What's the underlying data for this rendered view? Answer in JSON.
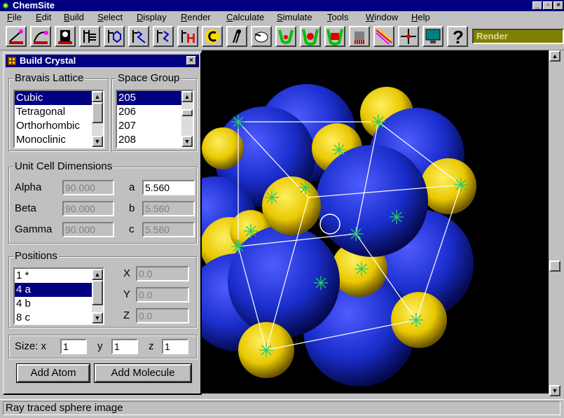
{
  "app": {
    "title": "ChemSite"
  },
  "window_controls": {
    "minimize": "_",
    "restore": "▫",
    "close": "×"
  },
  "menu": [
    {
      "label": "File",
      "mnemonic": "F",
      "rest": "ile"
    },
    {
      "label": "Edit",
      "mnemonic": "E",
      "rest": "dit"
    },
    {
      "label": "Build",
      "mnemonic": "B",
      "rest": "uild"
    },
    {
      "label": "Select",
      "mnemonic": "S",
      "rest": "elect"
    },
    {
      "label": "Display",
      "mnemonic": "D",
      "rest": "isplay"
    },
    {
      "label": "Render",
      "mnemonic": "R",
      "rest": "ender"
    },
    {
      "label": "Calculate",
      "mnemonic": "C",
      "rest": "alculate"
    },
    {
      "label": "Simulate",
      "mnemonic": "S",
      "rest": "imulate"
    },
    {
      "label": "Tools",
      "mnemonic": "T",
      "rest": "ools"
    },
    {
      "label": "Window",
      "mnemonic": "W",
      "rest": "indow"
    },
    {
      "label": "Help",
      "mnemonic": "H",
      "rest": "elp"
    }
  ],
  "toolbar": {
    "tools": [
      "select-bond-icon",
      "rotate-icon",
      "lasso-icon",
      "bond-tool-icon",
      "ring-tool-icon",
      "chain-tool-icon",
      "torsion-tool-icon",
      "hydrogen-tool-icon",
      "ring-c-icon",
      "bond-edit-icon",
      "mouse-icon",
      "magnet-icon",
      "cage-icon",
      "cage-red-icon",
      "comb-icon",
      "rainbow-icon",
      "crosshair-icon",
      "monitor-icon",
      "help-icon"
    ],
    "help_glyph": "?",
    "mode": "Render"
  },
  "dialog": {
    "title": "Build Crystal",
    "close": "×",
    "bravais": {
      "label": "Bravais Lattice",
      "items": [
        "Cubic",
        "Tetragonal",
        "Orthorhombic",
        "Monoclinic"
      ],
      "selected": 0
    },
    "space_group": {
      "label": "Space Group",
      "items": [
        "205",
        "206",
        "207",
        "208"
      ],
      "selected": 0
    },
    "unit_cell": {
      "label": "Unit Cell Dimensions",
      "alpha_label": "Alpha",
      "alpha": "90.000",
      "beta_label": "Beta",
      "beta": "90.000",
      "gamma_label": "Gamma",
      "gamma": "90.000",
      "a_label": "a",
      "a": "5.560",
      "b_label": "b",
      "b": "5.560",
      "c_label": "c",
      "c": "5.560"
    },
    "positions": {
      "label": "Positions",
      "items": [
        "1 *",
        "4 a",
        "4 b",
        "8 c"
      ],
      "selected": 1,
      "x_label": "X",
      "x": "0.0",
      "y_label": "Y",
      "y": "0.0",
      "z_label": "Z",
      "z": "0.0"
    },
    "size": {
      "label_x": "Size:  x",
      "x": "1",
      "label_y": "y",
      "y": "1",
      "label_z": "z",
      "z": "1"
    },
    "add_atom": "Add Atom",
    "add_molecule": "Add Molecule"
  },
  "viewport": {
    "colors": {
      "large_atom": "#1a2ecc",
      "small_atom": "#e8c800",
      "cell_edge": "#ffffff",
      "marker": "#22cc66",
      "background": "#000000"
    }
  },
  "status": {
    "text": "Ray traced sphere image"
  }
}
